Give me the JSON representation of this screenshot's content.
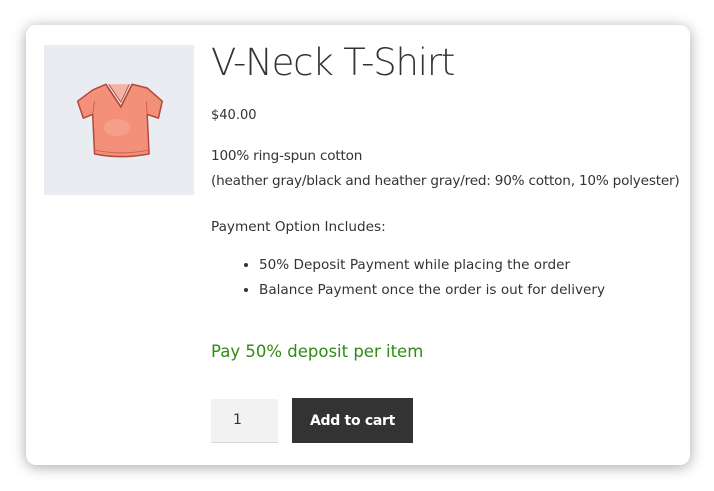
{
  "product": {
    "title": "V-Neck T-Shirt",
    "price": "$40.00",
    "description_line1": "100% ring-spun cotton",
    "description_line2": "(heather gray/black and heather gray/red: 90% cotton, 10% polyester)",
    "payment_label": "Payment Option Includes:",
    "payment_options": [
      "50% Deposit Payment while placing the order",
      "Balance Payment once the order is out for delivery"
    ],
    "deposit_notice": "Pay 50% deposit per item",
    "image_icon": "t-shirt-image"
  },
  "cart": {
    "quantity": "1",
    "add_to_cart_label": "Add to cart"
  },
  "colors": {
    "deposit_green": "#2e8b13",
    "button_bg": "#333333",
    "image_bg": "#e9edf2",
    "shirt_fill": "#f2907a"
  }
}
